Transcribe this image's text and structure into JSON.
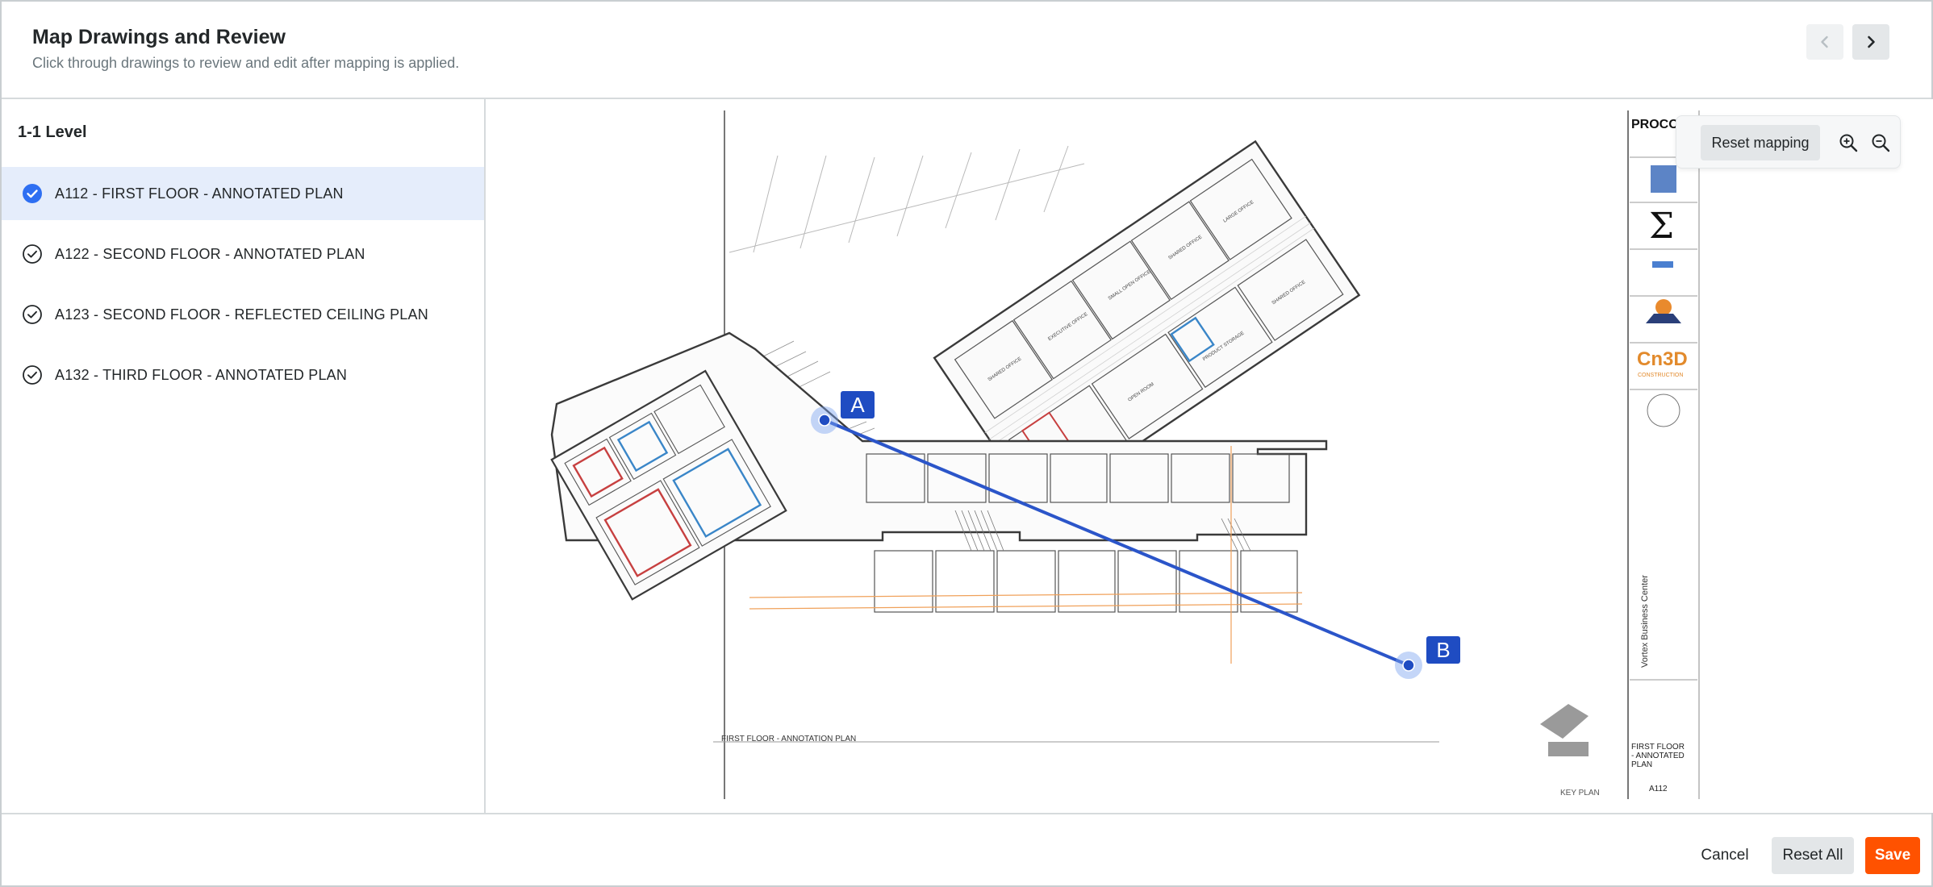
{
  "header": {
    "title": "Map Drawings and Review",
    "subtitle": "Click through drawings to review and edit after mapping is applied.",
    "prev_icon": "chevron-left-icon",
    "next_icon": "chevron-right-icon"
  },
  "sidebar": {
    "group_title": "1-1 Level",
    "items": [
      {
        "label": "A112 - FIRST FLOOR - ANNOTATED PLAN",
        "selected": true,
        "icon": "check-circle-filled-icon"
      },
      {
        "label": "A122 - SECOND FLOOR - ANNOTATED PLAN",
        "selected": false,
        "icon": "check-circle-outline-icon"
      },
      {
        "label": "A123 - SECOND FLOOR - REFLECTED CEILING PLAN",
        "selected": false,
        "icon": "check-circle-outline-icon"
      },
      {
        "label": "A132 - THIRD FLOOR - ANNOTATED PLAN",
        "selected": false,
        "icon": "check-circle-outline-icon"
      }
    ]
  },
  "canvas": {
    "toolbar": {
      "reset_mapping_label": "Reset mapping",
      "zoom_in_icon": "zoom-in-icon",
      "zoom_out_icon": "zoom-out-icon"
    },
    "drawing": {
      "point_a_label": "A",
      "point_b_label": "B",
      "plan_title": "FIRST FLOOR - ANNOTATION PLAN",
      "key_plan_label": "KEY PLAN",
      "titleblock_logo_text": "PROCO",
      "titleblock_logo2_text": "Cn3D",
      "titleblock_logo2_sub": "CONSTRUCTION",
      "project_name": "Vortex Business Center",
      "sheet_name": "FIRST FLOOR - ANNOTATED PLAN",
      "sheet_number": "A112",
      "mapping_line_color": "#2b55c9",
      "marker_color": "#1f4cc2"
    }
  },
  "footer": {
    "cancel_label": "Cancel",
    "reset_all_label": "Reset All",
    "save_label": "Save"
  },
  "colors": {
    "accent": "#ff5200",
    "selected_bg": "#e5edfb",
    "check_blue": "#2e6ff2"
  }
}
